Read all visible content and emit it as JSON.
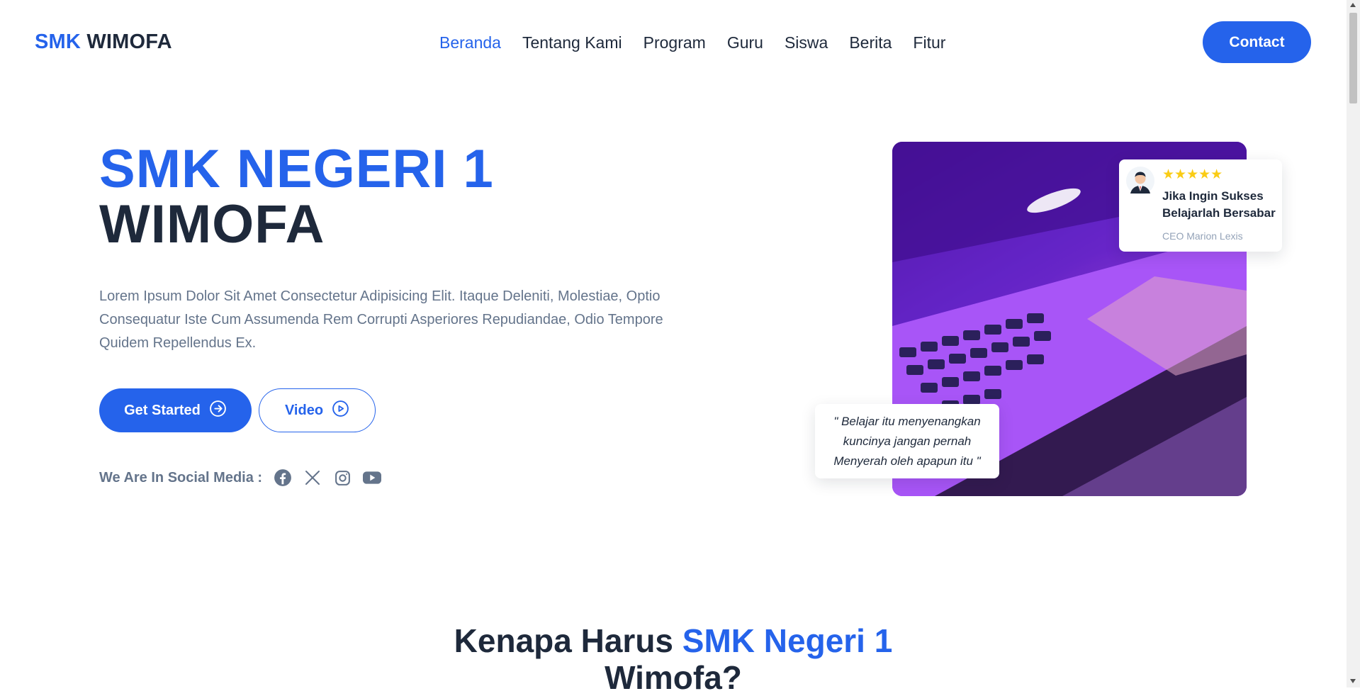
{
  "brand": {
    "part1": "SMK",
    "part2": "WIMOFA"
  },
  "nav": {
    "items": [
      {
        "label": "Beranda",
        "active": true
      },
      {
        "label": "Tentang Kami"
      },
      {
        "label": "Program"
      },
      {
        "label": "Guru"
      },
      {
        "label": "Siswa"
      },
      {
        "label": "Berita"
      },
      {
        "label": "Fitur"
      }
    ],
    "contact_label": "Contact"
  },
  "hero": {
    "title_line1": "SMK NEGERI 1",
    "title_line2": "WIMOFA",
    "description": "Lorem Ipsum Dolor Sit Amet Consectetur Adipisicing Elit. Itaque Deleniti, Molestiae, Optio Consequatur Iste Cum Assumenda Rem Corrupti Asperiores Repudiandae, Odio Tempore Quidem Repellendus Ex.",
    "get_started_label": "Get Started",
    "video_label": "Video",
    "social_label": "We Are In Social Media :",
    "social_icons": [
      "facebook-icon",
      "x-icon",
      "instagram-icon",
      "youtube-icon"
    ]
  },
  "testimonial": {
    "rating": 5,
    "stars": "★★★★★",
    "quote": "Jika Ingin Sukses Belajarlah Bersabar",
    "author": "CEO Marion Lexis"
  },
  "quote_card": {
    "text": "\" Belajar itu menyenangkan kuncinya jangan pernah Menyerah oleh apapun itu \""
  },
  "why": {
    "title_prefix": "Kenapa Harus",
    "title_highlight": "SMK Negeri 1",
    "title_suffix": "Wimofa?"
  },
  "colors": {
    "accent": "#2563eb",
    "dark": "#1e293b",
    "muted": "#64748b",
    "star": "#facc15"
  }
}
